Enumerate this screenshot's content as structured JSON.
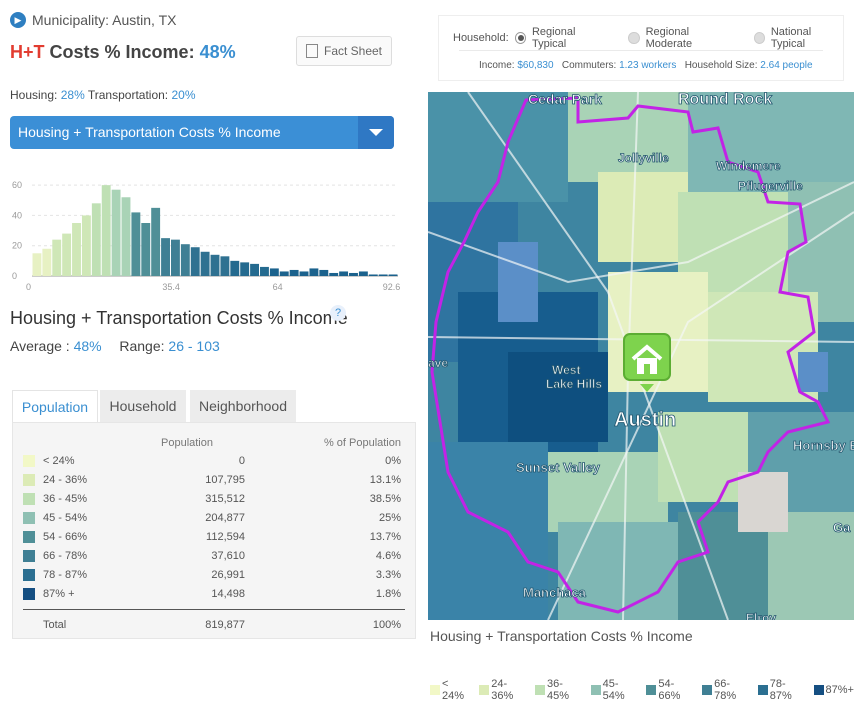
{
  "header": {
    "municipality": "Municipality: Austin, TX",
    "ht_prefix": "H+T",
    "ht_label": "Costs % Income:",
    "ht_value": "48%",
    "fact_sheet": "Fact Sheet",
    "housing_label": "Housing:",
    "housing_value": "28%",
    "transport_label": "Transportation:",
    "transport_value": "20%"
  },
  "dropdown": {
    "selected": "Housing + Transportation Costs % Income"
  },
  "histogram": {
    "yticks": [
      "60",
      "40",
      "20",
      "0"
    ],
    "xticks": [
      "0",
      "35.4",
      "64",
      "92.6"
    ]
  },
  "chart_data": {
    "type": "bar",
    "categories": [],
    "values": [
      15,
      18,
      24,
      28,
      35,
      40,
      48,
      60,
      57,
      52,
      42,
      35,
      45,
      25,
      24,
      21,
      19,
      16,
      14,
      13,
      10,
      9,
      8,
      6,
      5,
      3,
      4,
      3,
      5,
      4,
      2,
      3,
      2,
      3,
      1,
      1,
      1
    ],
    "colors": [
      "#e7f1c3",
      "#e7f1c3",
      "#cfe7b7",
      "#cfe7b7",
      "#cfe7b7",
      "#cfe7b7",
      "#bfe0b4",
      "#bfe0b4",
      "#a9d3b6",
      "#a9d3b6",
      "#4f8f97",
      "#4f8f97",
      "#4f8f97",
      "#3f7f94",
      "#3f7f94",
      "#3f7f94",
      "#2f7191",
      "#2f7191",
      "#2f7191",
      "#2f7191",
      "#246a8f",
      "#246a8f",
      "#246a8f",
      "#246a8f",
      "#1b628d",
      "#1b628d",
      "#1b628d",
      "#1b628d",
      "#1b628d",
      "#1b628d",
      "#1b628d",
      "#1b628d",
      "#1b628d",
      "#1b628d",
      "#1b628d",
      "#1b628d",
      "#1b628d"
    ],
    "ylim": [
      0,
      70
    ],
    "xlim": [
      0,
      95
    ],
    "xticks": [
      0,
      35.4,
      64,
      92.6
    ],
    "yticks": [
      0,
      20,
      40,
      60
    ],
    "grid": true,
    "title": "",
    "xlabel": "",
    "ylabel": ""
  },
  "metric": {
    "title": "Housing + Transportation Costs % Income",
    "help": "?",
    "avg_label": "Average :",
    "avg_value": "48%",
    "range_label": "Range:",
    "range_value": "26 - 103"
  },
  "tabs": [
    "Population",
    "Household",
    "Neighborhood"
  ],
  "table": {
    "col_population": "Population",
    "col_pct": "% of Population",
    "rows": [
      {
        "label": "< 24%",
        "pop": "0",
        "pct": "0%",
        "color": "#f2f8c7"
      },
      {
        "label": "24 - 36%",
        "pop": "107,795",
        "pct": "13.1%",
        "color": "#dcebb6"
      },
      {
        "label": "36 - 45%",
        "pop": "315,512",
        "pct": "38.5%",
        "color": "#bfe0b4"
      },
      {
        "label": "45 - 54%",
        "pop": "204,877",
        "pct": "25%",
        "color": "#8fc0b3"
      },
      {
        "label": "54 - 66%",
        "pop": "112,594",
        "pct": "13.7%",
        "color": "#4f8f97"
      },
      {
        "label": "66 - 78%",
        "pop": "37,610",
        "pct": "4.6%",
        "color": "#3f7f94"
      },
      {
        "label": "78 - 87%",
        "pop": "26,991",
        "pct": "3.3%",
        "color": "#2b6f91"
      },
      {
        "label": "87% +",
        "pop": "14,498",
        "pct": "1.8%",
        "color": "#154f82"
      }
    ],
    "total_label": "Total",
    "total_pop": "819,877",
    "total_pct": "100%"
  },
  "household_panel": {
    "label": "Household:",
    "options": [
      "Regional Typical",
      "Regional Moderate",
      "National Typical"
    ],
    "selected_index": 0,
    "income_label": "Income:",
    "income_value": "$60,830",
    "commuters_label": "Commuters:",
    "commuters_value": "1.23 workers",
    "size_label": "Household Size:",
    "size_value": "2.64 people"
  },
  "map": {
    "labels": [
      "Cedar Park",
      "Round Rock",
      "Jollyville",
      "Windemere",
      "Pflugerville",
      "West",
      "Lake Hills",
      "Austin",
      "Sunset Valley",
      "Hornsby B",
      "Manchaca",
      "Elroy",
      "Ga",
      "ave"
    ],
    "caption": "Housing + Transportation Costs % Income"
  },
  "legend": [
    {
      "label": "< 24%",
      "color": "#f2f8c7"
    },
    {
      "label": "24-36%",
      "color": "#dcebb6"
    },
    {
      "label": "36-45%",
      "color": "#bfe0b4"
    },
    {
      "label": "45-54%",
      "color": "#8fc0b3"
    },
    {
      "label": "54-66%",
      "color": "#4f8f97"
    },
    {
      "label": "66-78%",
      "color": "#3f7f94"
    },
    {
      "label": "78-87%",
      "color": "#2b6f91"
    },
    {
      "label": "87%+",
      "color": "#154f82"
    }
  ]
}
